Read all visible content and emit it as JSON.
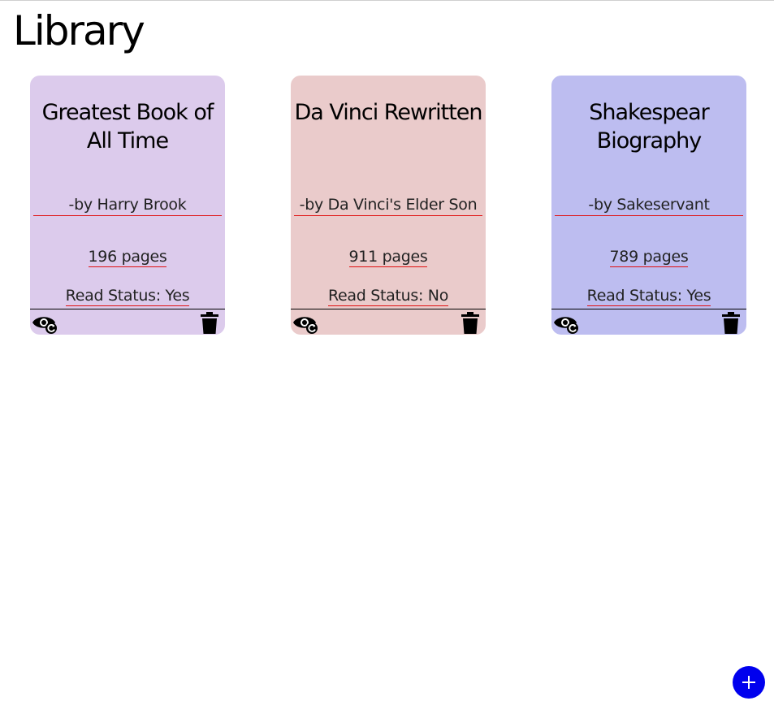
{
  "header": {
    "title": "Library"
  },
  "books": [
    {
      "title": "Greatest Book of All Time",
      "author": "-by Harry Brook",
      "pages": "196 pages",
      "read_status": "Read Status: Yes",
      "color": "#dccbec"
    },
    {
      "title": "Da Vinci Rewritten",
      "author": "-by Da Vinci's Elder Son",
      "pages": "911 pages",
      "read_status": "Read Status: No",
      "color": "#eacbcb"
    },
    {
      "title": "Shakespear Biography",
      "author": "-by Sakeservant",
      "pages": "789 pages",
      "read_status": "Read Status: Yes",
      "color": "#bdbdf0"
    }
  ],
  "icons": {
    "toggle": "eye-refresh-icon",
    "delete": "trash-icon",
    "add": "plus-icon"
  },
  "add_button": {
    "color": "#0000ee"
  }
}
